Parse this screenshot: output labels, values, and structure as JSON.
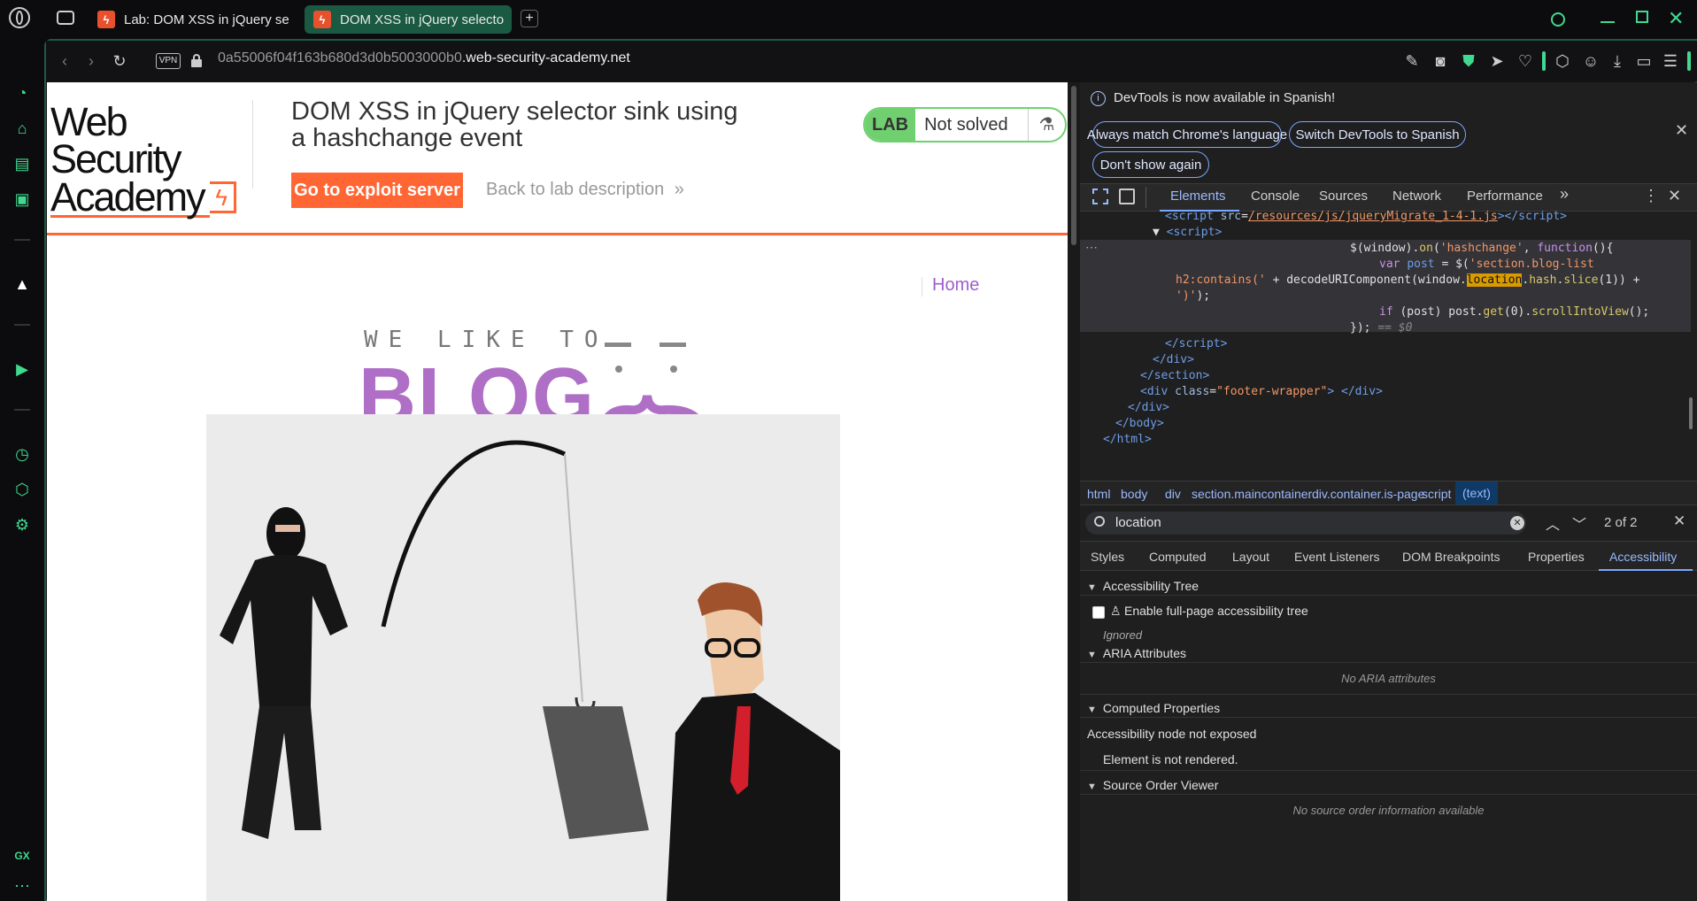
{
  "browser": {
    "tabs": [
      {
        "label": "Lab: DOM XSS in jQuery se",
        "active": false
      },
      {
        "label": "DOM XSS in jQuery selecto",
        "active": true
      }
    ],
    "new_tab_symbol": "+",
    "vpn_label": "VPN",
    "url_host": "0a55006f04f163b680d3d0b5003000b0",
    "url_domain": ".web-security-academy.net",
    "accent": "#3fd98f",
    "sidebar_bottom_label": "GX"
  },
  "lab": {
    "logo_line1": "Web Security",
    "logo_line2": "Academy",
    "title": "DOM XSS in jQuery selector sink using a hashchange event",
    "badge": "LAB",
    "status": "Not solved",
    "exploit_button": "Go to exploit server",
    "back_link": "Back to lab description",
    "nav_home": "Home",
    "blog_tagline": "WE LIKE TO",
    "blog_word": "BLOG",
    "brand_orange": "#ff6633",
    "blog_purple": "#b06fc6"
  },
  "devtools": {
    "infobar_text": "DevTools is now available in Spanish!",
    "infobar_buttons": [
      "Always match Chrome's language",
      "Switch DevTools to Spanish",
      "Don't show again"
    ],
    "tabs": [
      "Elements",
      "Console",
      "Sources",
      "Network",
      "Performance"
    ],
    "active_tab": "Elements",
    "more_tabs": "»",
    "code_lines": {
      "l1_src": "/resources/js/jqueryMigrate_1-4-1.js",
      "l8_attr": "\"footer-wrapper\""
    },
    "breadcrumbs": [
      "html",
      "body",
      "div",
      "section.maincontainer",
      "div.container.is-page",
      "script",
      "(text)"
    ],
    "search": {
      "value": "location",
      "count": "2 of 2"
    },
    "subtabs": [
      "Styles",
      "Computed",
      "Layout",
      "Event Listeners",
      "DOM Breakpoints",
      "Properties",
      "Accessibility"
    ],
    "active_subtab": "Accessibility",
    "a11y": {
      "tree_header": "Accessibility Tree",
      "fullpage_label": "Enable full-page accessibility tree",
      "ignored": "Ignored",
      "aria_header": "ARIA Attributes",
      "no_aria": "No ARIA attributes",
      "computed_header": "Computed Properties",
      "not_exposed": "Accessibility node not exposed",
      "not_rendered": "Element is not rendered.",
      "source_header": "Source Order Viewer",
      "no_source": "No source order information available"
    }
  }
}
